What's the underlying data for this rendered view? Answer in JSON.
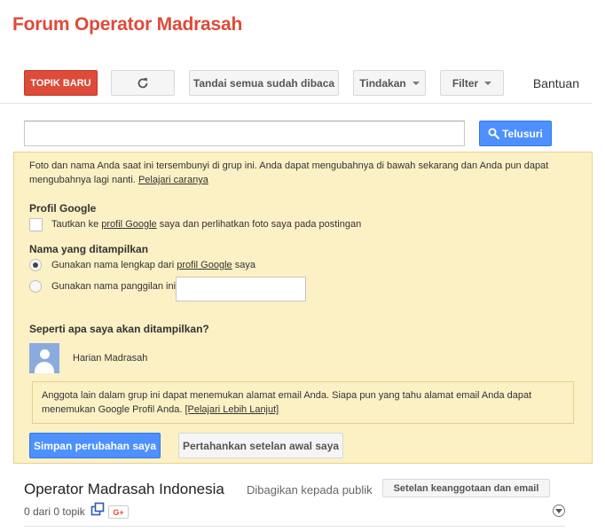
{
  "page": {
    "title": "Forum Operator Madrasah"
  },
  "toolbar": {
    "new_topic": "TOPIK BARU",
    "refresh_icon": "refresh-icon",
    "mark_all_read": "Tandai semua sudah dibaca",
    "actions": "Tindakan",
    "filter": "Filter",
    "help": "Bantuan"
  },
  "search": {
    "value": "",
    "placeholder": "",
    "button": "Telusuri",
    "icon": "search-icon"
  },
  "notice": {
    "text_before_link": "Foto dan nama Anda saat ini tersembunyi di grup ini. Anda dapat mengubahnya di bawah sekarang dan Anda pun dapat mengubahnya lagi nanti. ",
    "learn_link": "Pelajari caranya",
    "profile_section": "Profil Google",
    "link_profile_prefix": "Tautkan ke ",
    "link_profile_link": "profil Google",
    "link_profile_suffix": " saya dan perlihatkan foto saya pada postingan",
    "display_name_section": "Nama yang ditampilkan",
    "use_full_prefix": "Gunakan nama lengkap dari ",
    "use_full_link": "profil Google",
    "use_full_suffix": " saya",
    "use_nickname": "Gunakan nama panggilan ini:",
    "nickname_value": "",
    "preview_section": "Seperti apa saya akan ditampilkan?",
    "preview_name": "Harian Madrasah",
    "info_text": "Anggota lain dalam grup ini dapat menemukan alamat email Anda. Siapa pun yang tahu alamat email Anda dapat menemukan Google Profil Anda. ",
    "info_link": "[Pelajari Lebih Lanjut]",
    "save_button": "Simpan perubahan saya",
    "keep_button": "Pertahankan setelan awal saya"
  },
  "group": {
    "name": "Operator Madrasah Indonesia",
    "shared": "Dibagikan kepada publik",
    "membership_button": "Setelan keanggotaan dan email",
    "topic_count": "0 dari 0 topik",
    "gplus_label": "G+"
  },
  "colors": {
    "brand": "#dd4b39",
    "primary": "#4d90fe",
    "notice_bg": "#fcf0c5"
  }
}
